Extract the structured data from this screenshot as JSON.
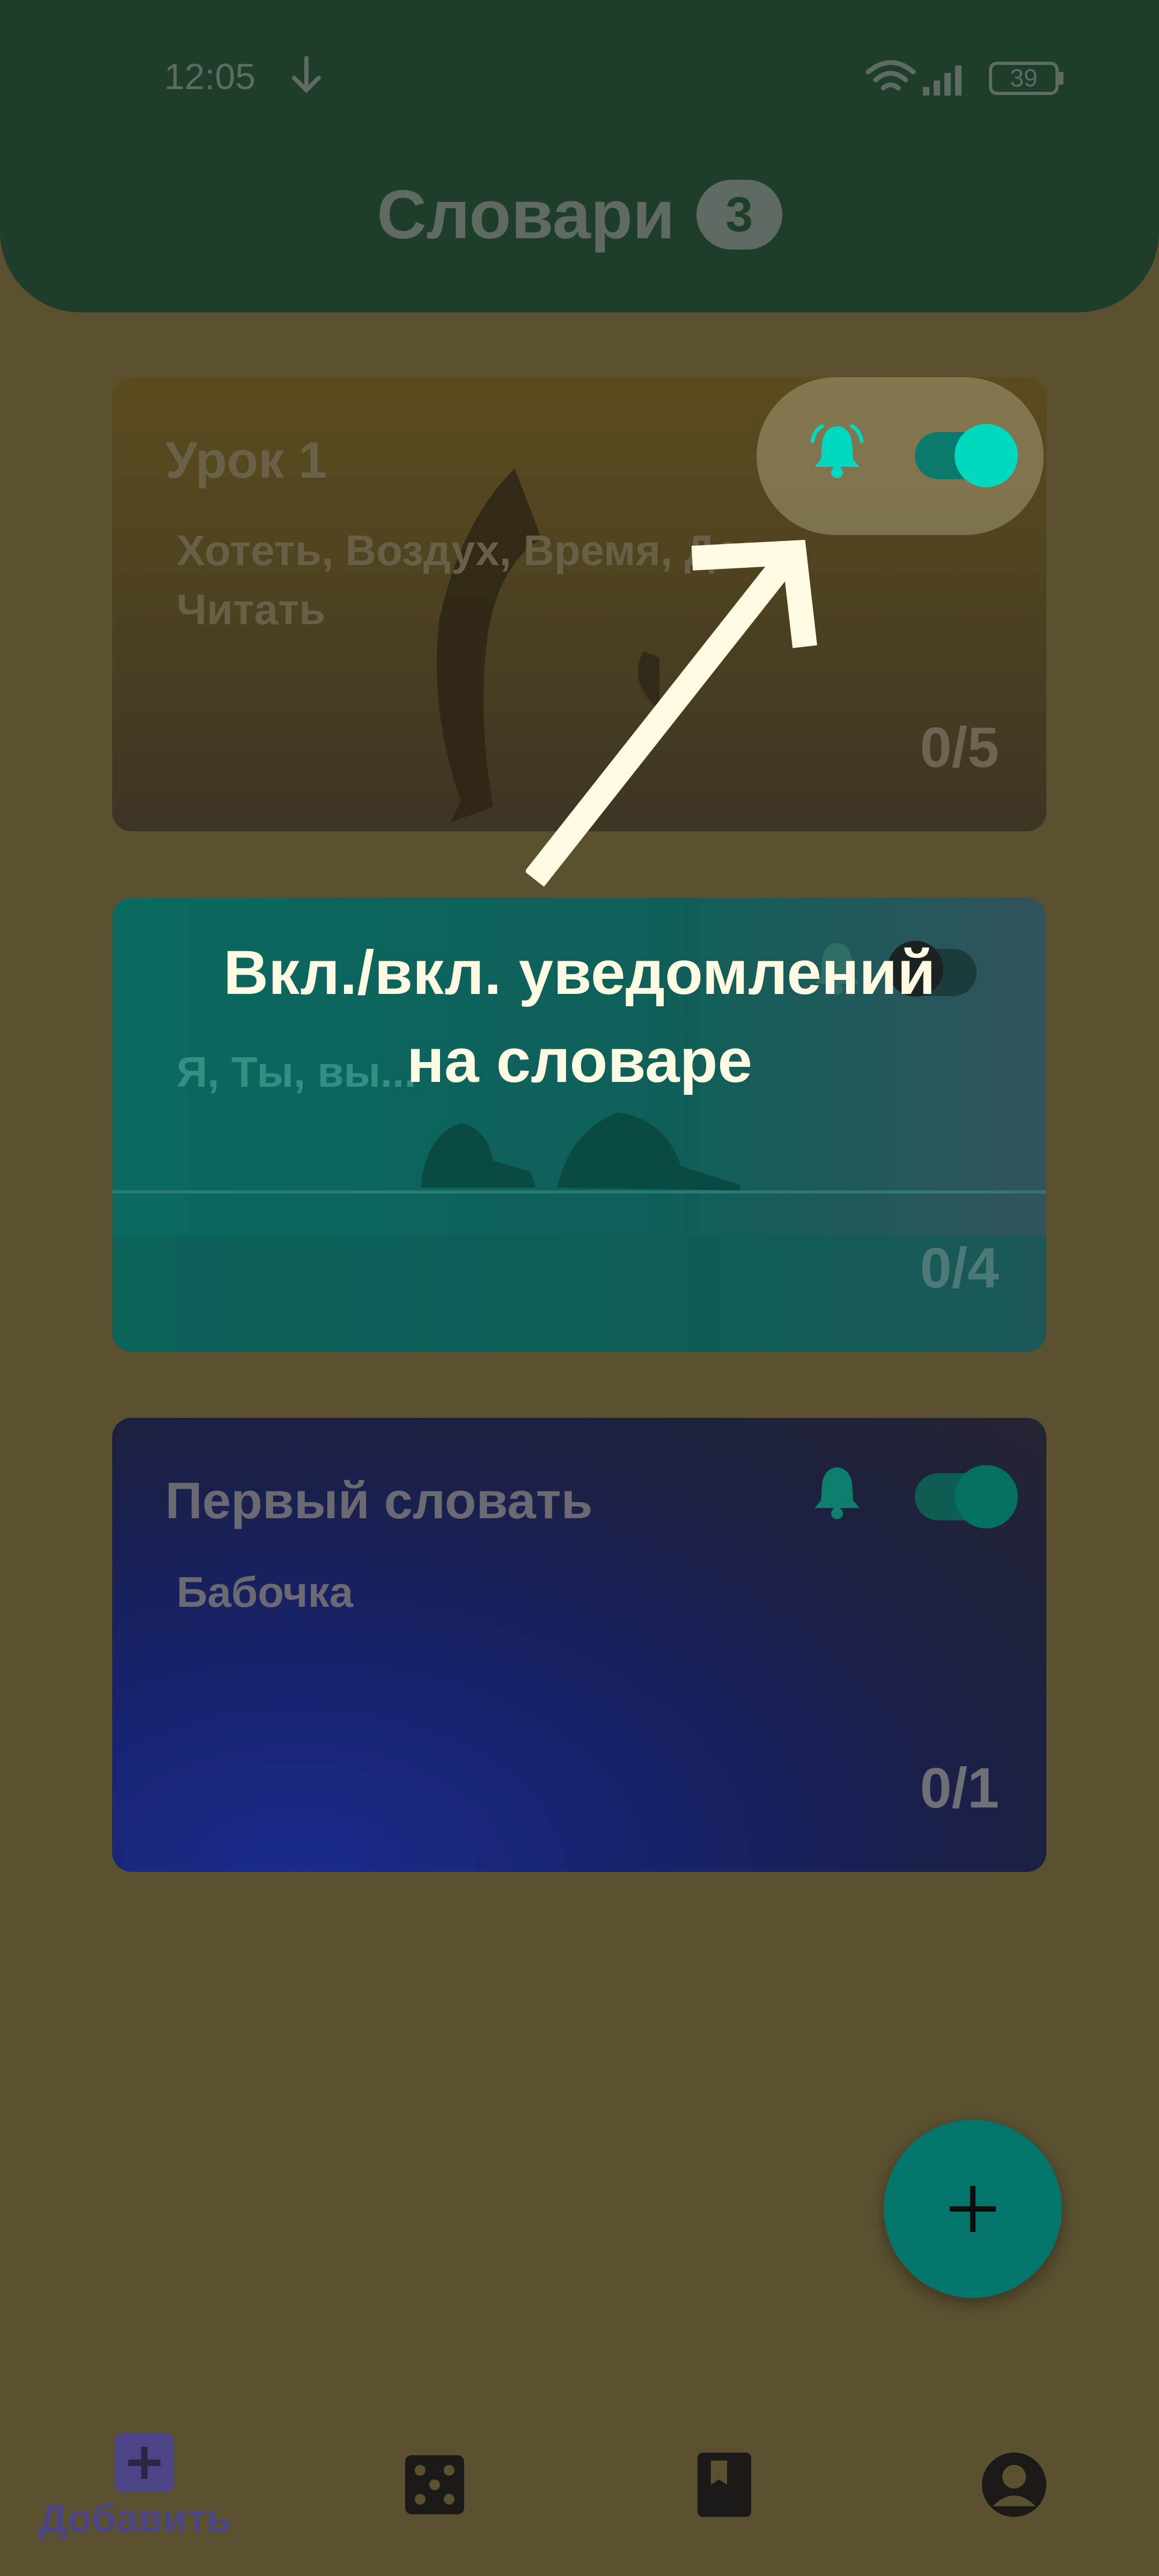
{
  "status_bar": {
    "time": "12:05",
    "battery": "39"
  },
  "header": {
    "title": "Словари",
    "count": "3"
  },
  "cards": [
    {
      "title": "Урок 1",
      "words": "Хотеть, Воздух, Время, Дом, Читать",
      "progress": "0/5",
      "notifications_on": true
    },
    {
      "title": "",
      "words": "Я, Ты, вы...",
      "progress": "0/4",
      "notifications_on": false
    },
    {
      "title": "Первый словать",
      "words": "Бабочка",
      "progress": "0/1",
      "notifications_on": true
    }
  ],
  "callout": {
    "line1": "Вкл./вкл. уведомлений",
    "line2": "на словаре"
  },
  "fab": {
    "label": "+"
  },
  "bottom_nav": {
    "add_label": "Добавить"
  },
  "colors": {
    "accent": "#00d8c0",
    "header": "#1e3d2b",
    "background": "#5b5131",
    "nav_active": "#4b4586"
  }
}
